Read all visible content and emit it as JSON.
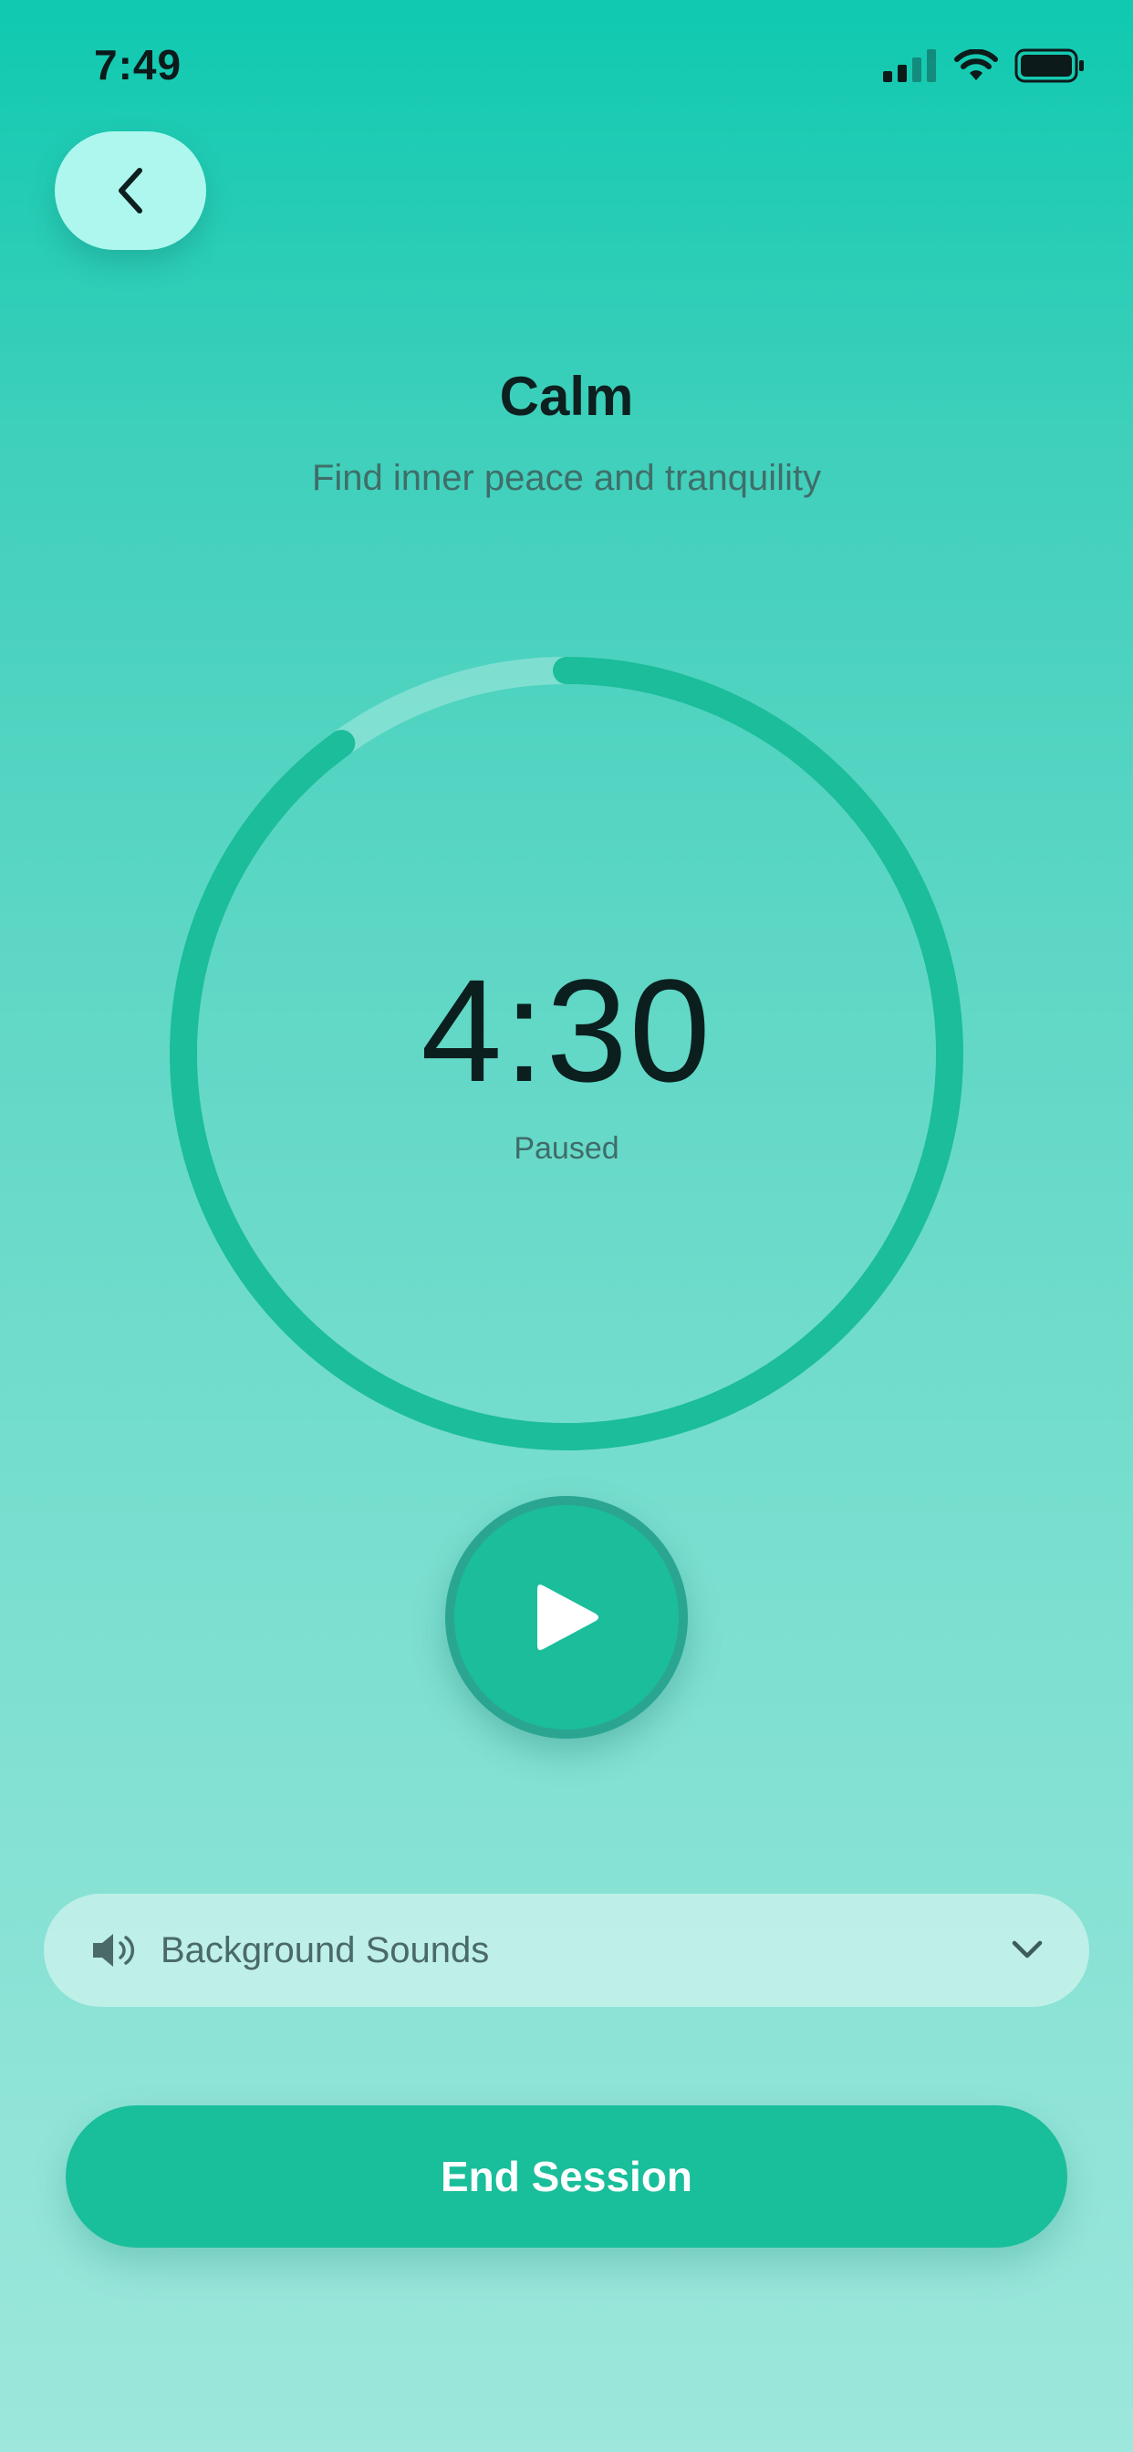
{
  "status_bar": {
    "time": "7:49",
    "icons": [
      "cellular-signal-icon",
      "wifi-icon",
      "battery-icon"
    ]
  },
  "header": {
    "back_icon": "chevron-left-icon"
  },
  "session": {
    "title": "Calm",
    "subtitle": "Find inner peace and tranquility"
  },
  "timer": {
    "time": "4:30",
    "status": "Paused",
    "progress_remaining": 0.9,
    "ring_color": "#1bbd9b"
  },
  "controls": {
    "play_icon": "play-icon"
  },
  "sounds": {
    "icon": "speaker-icon",
    "label": "Background Sounds",
    "chevron": "chevron-down-icon"
  },
  "footer": {
    "end_label": "End Session"
  },
  "colors": {
    "accent": "#1bbd9b",
    "back_button": "#aef7ee",
    "text_dark": "#0d1f1f"
  }
}
